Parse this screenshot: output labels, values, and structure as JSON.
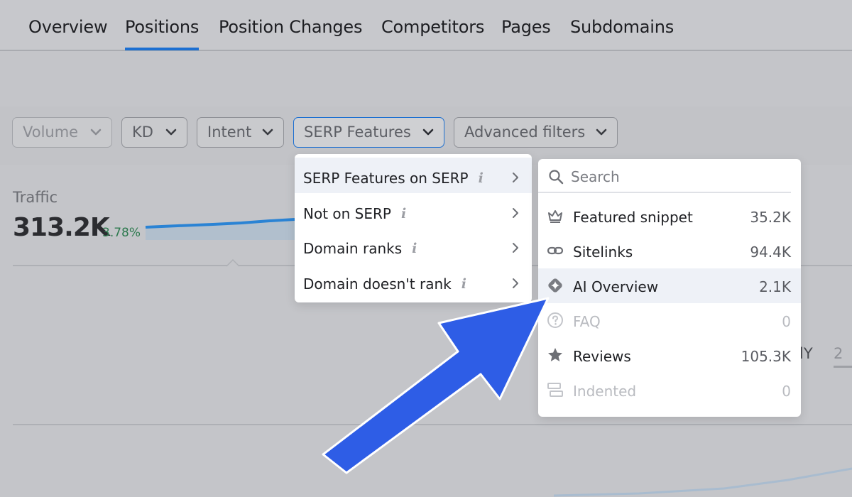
{
  "tabs": [
    {
      "label": "Overview",
      "active": false
    },
    {
      "label": "Positions",
      "active": true
    },
    {
      "label": "Position Changes",
      "active": false
    },
    {
      "label": "Competitors",
      "active": false
    },
    {
      "label": "Pages",
      "active": false
    },
    {
      "label": "Subdomains",
      "active": false
    }
  ],
  "filters": [
    {
      "label": "Volume",
      "icon": "chevron-down-icon"
    },
    {
      "label": "KD",
      "icon": "chevron-down-icon"
    },
    {
      "label": "Intent",
      "icon": "chevron-down-icon"
    },
    {
      "label": "SERP Features",
      "icon": "chevron-down-icon",
      "open": true
    },
    {
      "label": "Advanced filters",
      "icon": "chevron-down-icon"
    }
  ],
  "traffic": {
    "label": "Traffic",
    "value": "313.2K",
    "change": "3.78%"
  },
  "background_partial": {
    "period_label": "lY",
    "period_next": "2"
  },
  "serp_menu": {
    "items": [
      {
        "label": "SERP Features on SERP",
        "info": "i",
        "hovered": true
      },
      {
        "label": "Not on SERP",
        "info": "i"
      },
      {
        "label": "Domain ranks",
        "info": "i"
      },
      {
        "label": "Domain doesn't rank",
        "info": "i"
      }
    ]
  },
  "submenu": {
    "search_placeholder": "Search",
    "features": [
      {
        "label": "Featured snippet",
        "count": "35.2K",
        "icon": "crown-icon",
        "disabled": false
      },
      {
        "label": "Sitelinks",
        "count": "94.4K",
        "icon": "link-icon",
        "disabled": false
      },
      {
        "label": "AI Overview",
        "count": "2.1K",
        "icon": "ai-sparkle-icon",
        "disabled": false,
        "hovered": true
      },
      {
        "label": "FAQ",
        "count": "0",
        "icon": "question-circle-icon",
        "disabled": true
      },
      {
        "label": "Reviews",
        "count": "105.3K",
        "icon": "star-icon",
        "disabled": false
      },
      {
        "label": "Indented",
        "count": "0",
        "icon": "indented-icon",
        "disabled": true
      }
    ]
  },
  "colors": {
    "accent": "#1c6fd1",
    "arrow": "#2e5de6",
    "positive": "#2e7a4f",
    "overlay": "#c4c5c9"
  }
}
